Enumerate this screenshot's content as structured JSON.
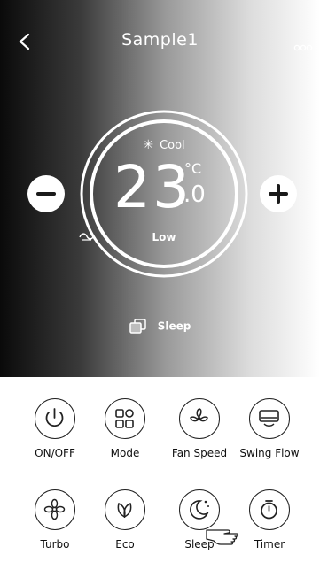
{
  "header": {
    "title": "Sample1",
    "back_icon": "chevron-left-icon",
    "more_icon": "more-dots-icon"
  },
  "display": {
    "mode_icon": "snowflake-icon",
    "mode": "Cool",
    "temperature": "23",
    "unit": "°C",
    "decimal": ".0",
    "fan_icon": "fan-speed-icon",
    "fan_speed": "Low",
    "sleep_icon": "sleep-copy-icon",
    "sleep": "Sleep"
  },
  "controls": {
    "minus_icon": "minus-icon",
    "plus_icon": "plus-icon"
  },
  "buttons": [
    {
      "label": "ON/OFF",
      "icon": "power-icon"
    },
    {
      "label": "Mode",
      "icon": "mode-grid-icon"
    },
    {
      "label": "Fan Speed",
      "icon": "fan-icon"
    },
    {
      "label": "Swing Flow",
      "icon": "swing-flow-icon"
    },
    {
      "label": "Turbo",
      "icon": "turbo-icon"
    },
    {
      "label": "Eco",
      "icon": "eco-leaf-icon"
    },
    {
      "label": "Sleep",
      "icon": "sleep-moon-icon"
    },
    {
      "label": "Timer",
      "icon": "timer-icon"
    }
  ],
  "colors": {
    "panel_dark": "#0a0a0a",
    "panel_light": "#ffffff",
    "text_on_panel": "#ffffff",
    "icon_stroke": "#222222"
  }
}
